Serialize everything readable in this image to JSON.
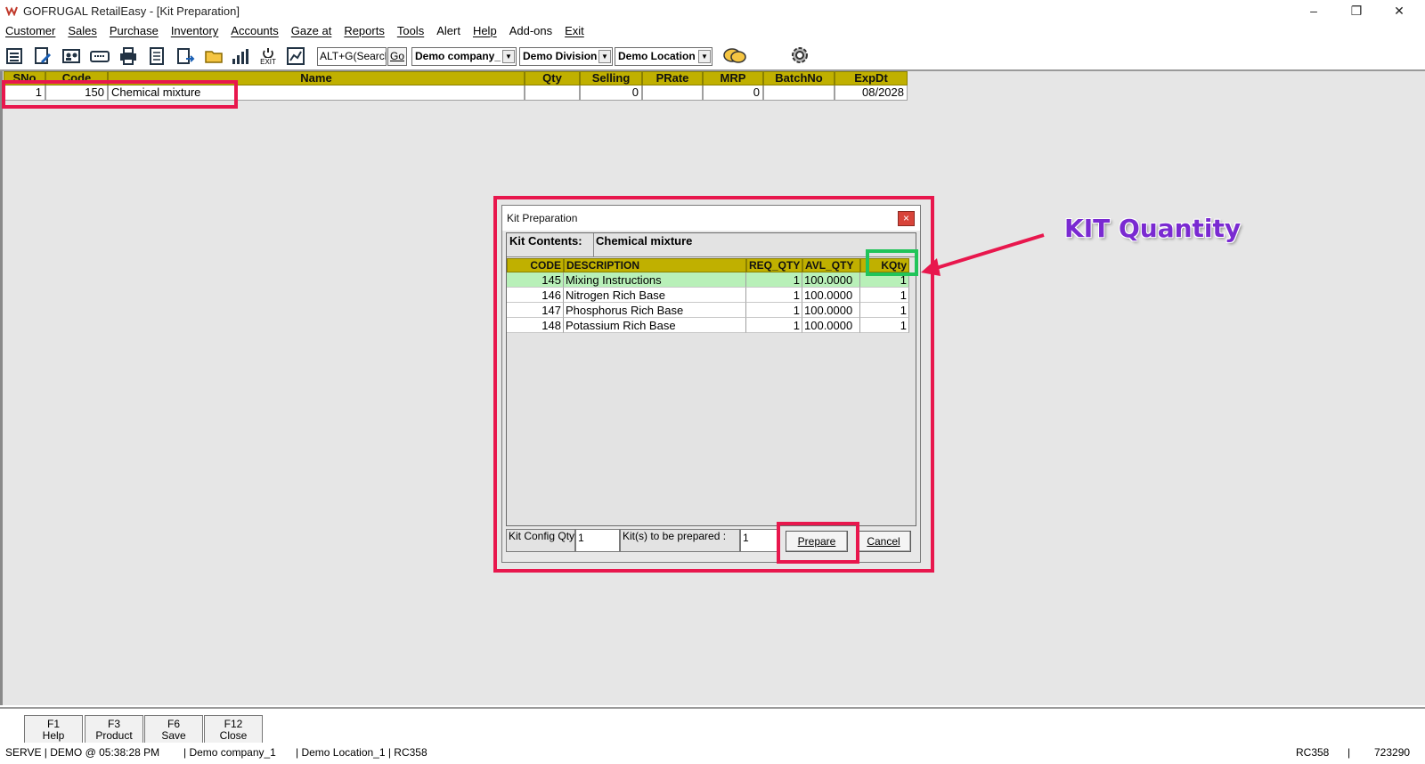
{
  "window": {
    "title": "GOFRUGAL RetailEasy - [Kit Preparation]",
    "minimize": "–",
    "restore": "❐",
    "close": "✕"
  },
  "menu": [
    "Customer",
    "Sales",
    "Purchase",
    "Inventory",
    "Accounts",
    "Gaze at",
    "Reports",
    "Tools",
    "Alert",
    "Help",
    "Add-ons",
    "Exit"
  ],
  "toolbar": {
    "search_value": "ALT+G(Search",
    "go_label": "Go",
    "company": "Demo company_",
    "division": "Demo Division",
    "location": "Demo Location",
    "icons": [
      "list-icon",
      "edit-document-icon",
      "contacts-icon",
      "keyboard-icon",
      "print-icon",
      "report-icon",
      "transfer-icon",
      "folder-icon",
      "bar-chart-icon",
      "exit-icon",
      "graph-icon",
      "chat-icon",
      "settings-icon"
    ],
    "exit_label": "EXIT"
  },
  "main_grid": {
    "headers": [
      "SNo",
      "Code",
      "Name",
      "Qty",
      "Selling",
      "PRate",
      "MRP",
      "BatchNo",
      "ExpDt"
    ],
    "row": {
      "sno": "1",
      "code": "150",
      "name": "Chemical mixture",
      "qty": "",
      "selling": "0",
      "prate": "",
      "mrp": "0",
      "batchno": "",
      "expdt": "08/2028"
    }
  },
  "annotation": {
    "label": "KIT Quantity",
    "color": "#7a2ad1",
    "highlight_color": "#e8174d",
    "green_color": "#21c45a"
  },
  "dialog": {
    "title": "Kit Preparation",
    "close": "×",
    "kit_contents_label": "Kit Contents:",
    "kit_contents_value": "Chemical mixture",
    "headers": [
      "CODE",
      "DESCRIPTION",
      "REQ_QTY",
      "AVL_QTY",
      "KQty"
    ],
    "rows": [
      {
        "code": "145",
        "description": "Mixing Instructions",
        "req_qty": "1",
        "avl_qty": "100.0000",
        "kqty": "1"
      },
      {
        "code": "146",
        "description": "Nitrogen Rich Base",
        "req_qty": "1",
        "avl_qty": "100.0000",
        "kqty": "1"
      },
      {
        "code": "147",
        "description": "Phosphorus Rich Base",
        "req_qty": "1",
        "avl_qty": "100.0000",
        "kqty": "1"
      },
      {
        "code": "148",
        "description": "Potassium Rich Base",
        "req_qty": "1",
        "avl_qty": "100.0000",
        "kqty": "1"
      }
    ],
    "kit_config_qty_label": "Kit Config Qty",
    "kit_config_qty_value": "1",
    "kits_to_prepare_label": "Kit(s) to be prepared :",
    "kits_to_prepare_value": "1",
    "prepare_label": "Prepare",
    "cancel_label": "Cancel"
  },
  "fkeys": [
    {
      "key": "F1",
      "label": "Help"
    },
    {
      "key": "F3",
      "label": "Product"
    },
    {
      "key": "F6",
      "label": "Save"
    },
    {
      "key": "F12",
      "label": "Close"
    }
  ],
  "status": {
    "left": "SERVE | DEMO  @ 05:38:28 PM",
    "company": "| Demo company_1",
    "location": "| Demo Location_1 | RC358",
    "right_code": "RC358",
    "sep": "|",
    "right_num": "723290"
  }
}
